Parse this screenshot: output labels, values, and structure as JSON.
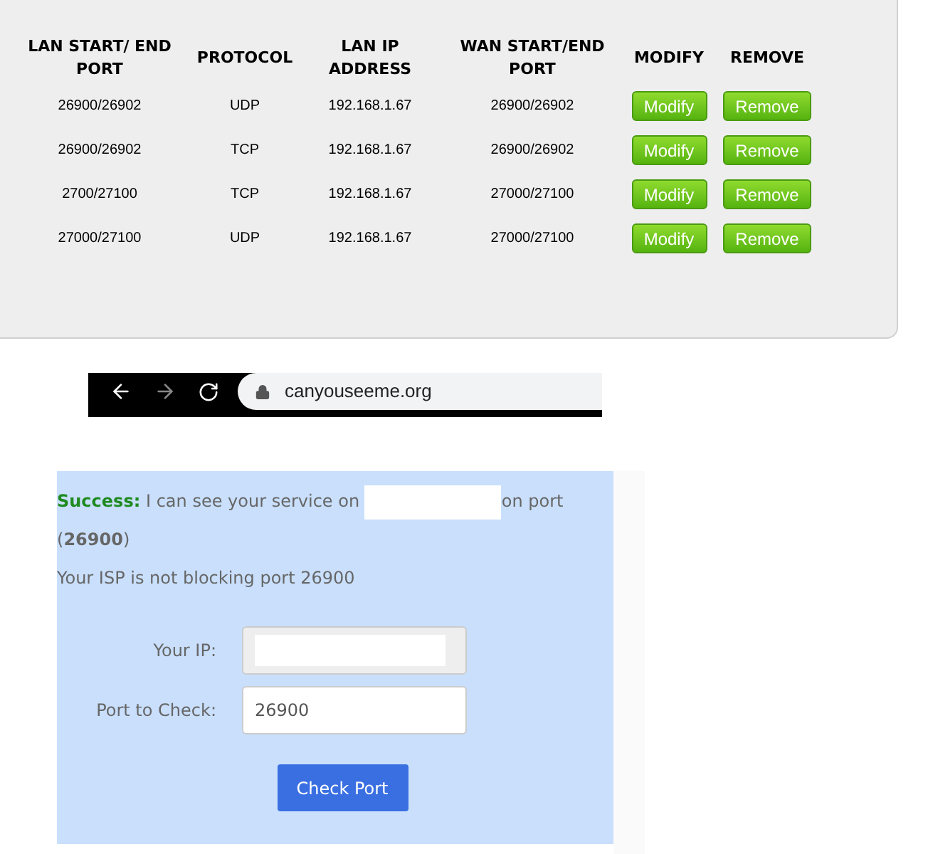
{
  "table": {
    "columns": [
      "LAN START/ END PORT",
      "PROTOCOL",
      "LAN IP ADDRESS",
      "WAN START/END PORT",
      "MODIFY",
      "REMOVE"
    ],
    "rows": [
      {
        "lan_port": "26900/26902",
        "protocol": "UDP",
        "lan_ip": "192.168.1.67",
        "wan_port": "26900/26902",
        "modify": "Modify",
        "remove": "Remove"
      },
      {
        "lan_port": "26900/26902",
        "protocol": "TCP",
        "lan_ip": "192.168.1.67",
        "wan_port": "26900/26902",
        "modify": "Modify",
        "remove": "Remove"
      },
      {
        "lan_port": "2700/27100",
        "protocol": "TCP",
        "lan_ip": "192.168.1.67",
        "wan_port": "27000/27100",
        "modify": "Modify",
        "remove": "Remove"
      },
      {
        "lan_port": "27000/27100",
        "protocol": "UDP",
        "lan_ip": "192.168.1.67",
        "wan_port": "27000/27100",
        "modify": "Modify",
        "remove": "Remove"
      }
    ]
  },
  "browser": {
    "url": "canyouseeme.org"
  },
  "result": {
    "label": "Success:",
    "message": "I can see your service on",
    "message_end": "on port",
    "port": "(**26900**)",
    "isp_note": "Your ISP is not blocking port 26900"
  },
  "form": {
    "ip_label": "Your IP:",
    "port_label": "Port to Check:",
    "port_value": "26900",
    "button": "Check Port"
  }
}
